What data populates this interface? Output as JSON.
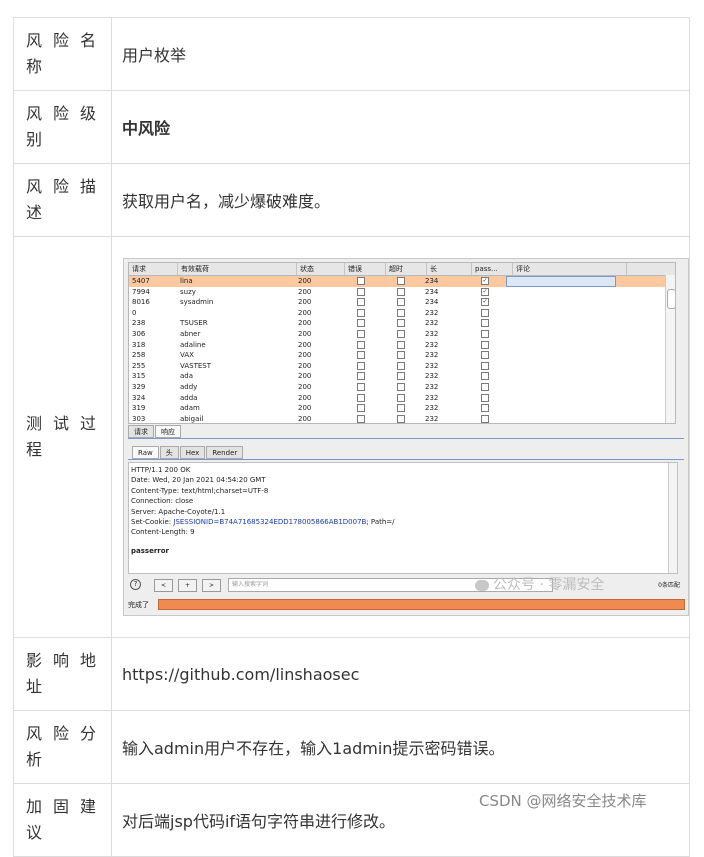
{
  "rows": [
    {
      "label": "风险名称",
      "value": "用户枚举"
    },
    {
      "label": "风险级别",
      "value": "中风险"
    },
    {
      "label": "风险描述",
      "value": "获取用户名，减少爆破难度。"
    },
    {
      "label": "测试过程"
    },
    {
      "label": "影响地址",
      "value": "https://github.com/linshaosec"
    },
    {
      "label": "风险分析",
      "value": "输入admin用户不存在，输入1admin提示密码错误。"
    },
    {
      "label": "加固建议",
      "value": "对后端jsp代码if语句字符串进行修改。"
    }
  ],
  "screenshot": {
    "columns": [
      "请求",
      "有效载荷",
      "状态",
      "错误",
      "超时",
      "长",
      "pass...",
      "评论"
    ],
    "results": [
      {
        "req": "5407",
        "payload": "lina",
        "status": "200",
        "length": "234",
        "checked": true,
        "selected": true
      },
      {
        "req": "7994",
        "payload": "suzy",
        "status": "200",
        "length": "234",
        "checked": true
      },
      {
        "req": "8016",
        "payload": "sysadmin",
        "status": "200",
        "length": "234",
        "checked": true
      },
      {
        "req": "0",
        "payload": "",
        "status": "200",
        "length": "232",
        "checked": false
      },
      {
        "req": "238",
        "payload": "TSUSER",
        "status": "200",
        "length": "232",
        "checked": false
      },
      {
        "req": "306",
        "payload": "abner",
        "status": "200",
        "length": "232",
        "checked": false
      },
      {
        "req": "318",
        "payload": "adaline",
        "status": "200",
        "length": "232",
        "checked": false
      },
      {
        "req": "258",
        "payload": "VAX",
        "status": "200",
        "length": "232",
        "checked": false
      },
      {
        "req": "255",
        "payload": "VASTEST",
        "status": "200",
        "length": "232",
        "checked": false
      },
      {
        "req": "315",
        "payload": "ada",
        "status": "200",
        "length": "232",
        "checked": false
      },
      {
        "req": "329",
        "payload": "addy",
        "status": "200",
        "length": "232",
        "checked": false
      },
      {
        "req": "324",
        "payload": "adda",
        "status": "200",
        "length": "232",
        "checked": false
      },
      {
        "req": "319",
        "payload": "adam",
        "status": "200",
        "length": "232",
        "checked": false
      },
      {
        "req": "303",
        "payload": "abigail",
        "status": "200",
        "length": "232",
        "checked": false
      }
    ],
    "tabs_top": [
      "请求",
      "响应"
    ],
    "tabs_view": [
      "Raw",
      "头",
      "Hex",
      "Render"
    ],
    "response": {
      "line1": "HTTP/1.1 200 OK",
      "line2": "Date: Wed, 20 Jan 2021 04:54:20 GMT",
      "line3": "Content-Type: text/html;charset=UTF-8",
      "line4": "Connection: close",
      "line5": "Server: Apache-Coyote/1.1",
      "cookie_prefix": "Set-Cookie: ",
      "cookie_value": "JSESSIONID=B74A71685324EDD178005866AB1D007B",
      "cookie_suffix": "; Path=/",
      "line7": "Content-Length: 9",
      "body": "passerror"
    },
    "search": {
      "help": "?",
      "prev": "<",
      "add": "+",
      "next": ">",
      "placeholder": "输入搜索字词",
      "matches": "0条匹配"
    },
    "status_text": "完成了",
    "watermark": "公众号 · 零漏安全"
  },
  "corner_watermark": "CSDN @网络安全技术库"
}
